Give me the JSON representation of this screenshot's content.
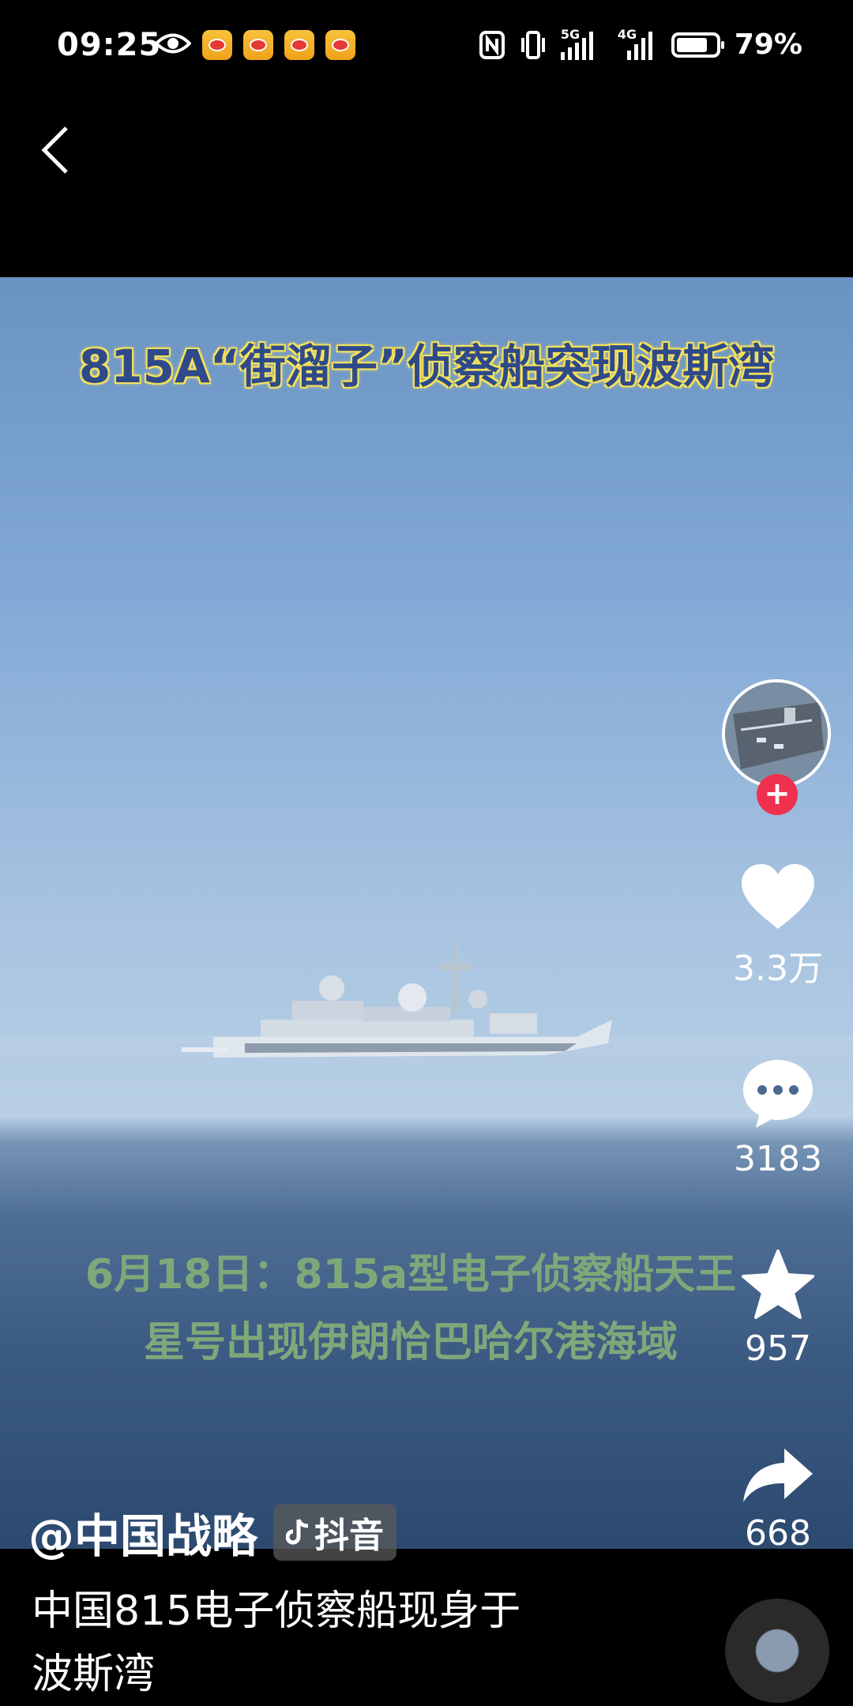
{
  "status_bar": {
    "time": "09:25",
    "network_5g": "5G",
    "network_4g": "4G",
    "battery_percent": "79%",
    "battery_level": 0.79
  },
  "video": {
    "title_overlay": "815A“街溜子”侦察船突现波斯湾",
    "caption_line1": "6月18日：815a型电子侦察船天王",
    "caption_line2": "星号出现伊朗恰巴哈尔港海域"
  },
  "actions": {
    "likes": "3.3万",
    "comments": "3183",
    "favorites": "957",
    "shares": "668"
  },
  "author": {
    "name": "@中国战略",
    "platform": "抖音"
  },
  "description": {
    "line1": "中国815电子侦察船现身于",
    "line2": "波斯湾"
  },
  "colors": {
    "follow_plus": "#f0304f",
    "title_glow": "#f6e25a",
    "caption": "#7da97a"
  }
}
